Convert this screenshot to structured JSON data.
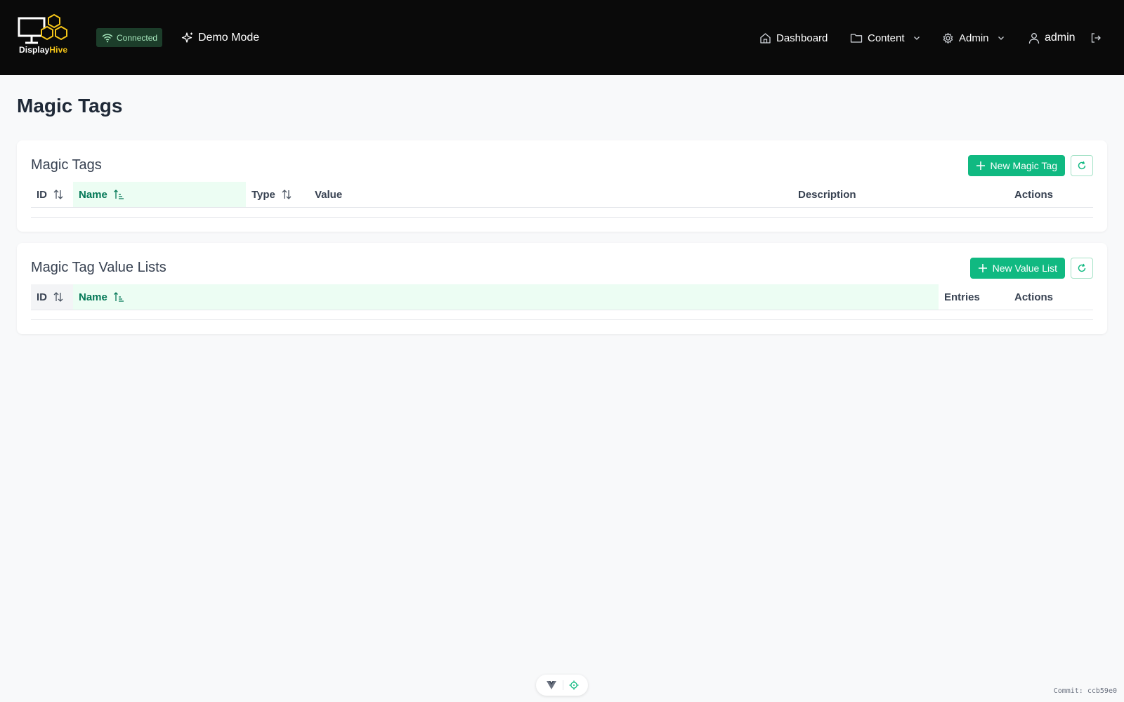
{
  "navbar": {
    "logo": {
      "text_prefix": "Display",
      "text_suffix": "Hive",
      "accent": "#f5c518"
    },
    "status_badge": {
      "label": "Connected",
      "icon": "wifi-icon"
    },
    "demo_mode": {
      "label": "Demo Mode",
      "icon": "sparkles-icon"
    },
    "items": [
      {
        "label": "Dashboard",
        "icon": "home-icon"
      },
      {
        "label": "Content",
        "icon": "folder-icon",
        "dropdown": true
      },
      {
        "label": "Admin",
        "icon": "gear-icon",
        "dropdown": true
      }
    ],
    "user": {
      "label": "admin",
      "icon": "user-icon"
    },
    "logout_icon": "logout-icon"
  },
  "page": {
    "title": "Magic Tags"
  },
  "magic_tags_card": {
    "title": "Magic Tags",
    "new_button_label": "New Magic Tag",
    "refresh_icon": "refresh-icon",
    "columns": [
      {
        "label": "ID",
        "sortable": true,
        "sorted": false
      },
      {
        "label": "Name",
        "sortable": true,
        "sorted": true
      },
      {
        "label": "Type",
        "sortable": true,
        "sorted": false
      },
      {
        "label": "Value",
        "sortable": false
      },
      {
        "label": "Description",
        "sortable": false
      },
      {
        "label": "Actions",
        "sortable": false
      }
    ],
    "rows": []
  },
  "value_lists_card": {
    "title": "Magic Tag Value Lists",
    "new_button_label": "New Value List",
    "refresh_icon": "refresh-icon",
    "columns": [
      {
        "label": "ID",
        "sortable": true,
        "sorted": false
      },
      {
        "label": "Name",
        "sortable": true,
        "sorted": true
      },
      {
        "label": "Entries",
        "sortable": false
      },
      {
        "label": "Actions",
        "sortable": false
      }
    ],
    "rows": []
  },
  "footer": {
    "commit": "Commit: ccb59e0",
    "devtools_icons": [
      "vue-logo-icon",
      "target-icon"
    ]
  },
  "colors": {
    "primary": "#10b981",
    "navbar_bg": "#0a0a0a",
    "sorted_header_bg": "#ecfdf3",
    "sorted_header_text": "#047857"
  }
}
